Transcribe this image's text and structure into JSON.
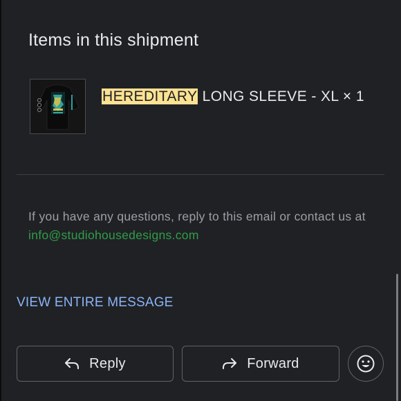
{
  "shipment": {
    "title": "Items in this shipment",
    "item": {
      "name_highlight": "HEREDITARY",
      "name_rest": " LONG SLEEVE - XL × 1",
      "thumbnail_icon": "long-sleeve-shirt-thumbnail"
    }
  },
  "contact": {
    "text": "If you have any questions, reply to this email or contact us at ",
    "email": "info@studiohousedesigns.com"
  },
  "view_message_label": "VIEW ENTIRE MESSAGE",
  "actions": {
    "reply_label": "Reply",
    "forward_label": "Forward",
    "reply_icon": "reply-arrow-icon",
    "forward_icon": "forward-arrow-icon",
    "emoji_icon": "smiley-face-icon"
  },
  "colors": {
    "background": "#202124",
    "highlight": "#fde293",
    "link_green": "#2e9e4a",
    "link_blue": "#8ab4f8"
  }
}
